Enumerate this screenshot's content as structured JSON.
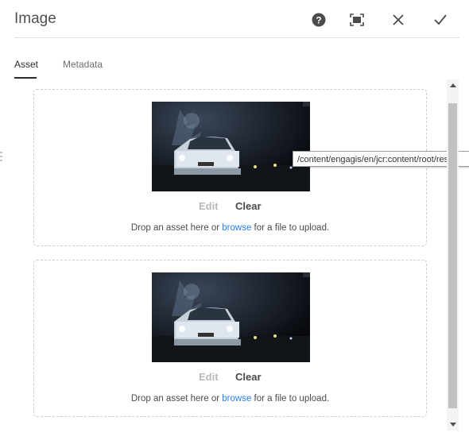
{
  "dialog": {
    "title": "Image",
    "icons": {
      "help": "help-icon",
      "fullscreen": "fullscreen-icon",
      "close": "close-icon",
      "done": "checkmark-icon"
    }
  },
  "tabs": [
    {
      "label": "Asset",
      "active": true
    },
    {
      "label": "Metadata",
      "active": false
    }
  ],
  "panels": [
    {
      "edit_label": "Edit",
      "clear_label": "Clear",
      "drop_prefix": "Drop an asset here or",
      "browse_label": "browse",
      "drop_suffix": "for a file to upload."
    },
    {
      "edit_label": "Edit",
      "clear_label": "Clear",
      "drop_prefix": "Drop an asset here or",
      "browse_label": "browse",
      "drop_suffix": "for a file to upload."
    }
  ],
  "tooltip": "/content/engagis/en/jcr:content/root/res",
  "colors": {
    "link": "#2680eb",
    "disabled": "#b8b8b8",
    "text": "#4b4b4b"
  }
}
